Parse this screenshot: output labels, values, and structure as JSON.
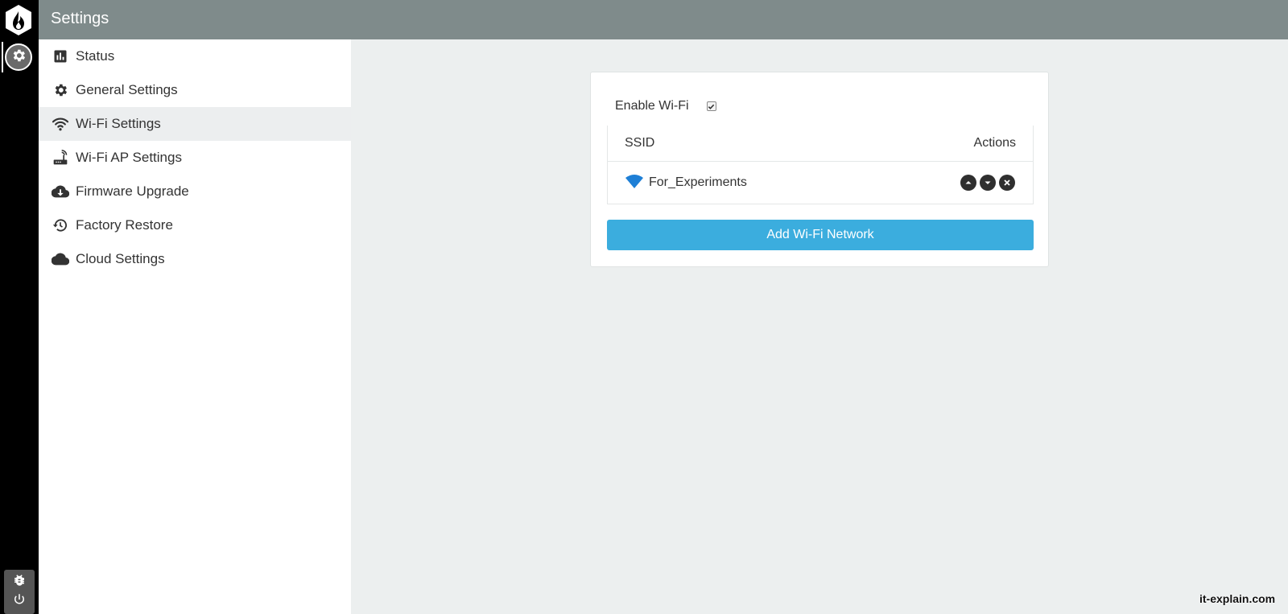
{
  "header": {
    "title": "Settings"
  },
  "sidebar": {
    "items": [
      {
        "label": "Status",
        "icon": "bar-chart-icon",
        "active": false
      },
      {
        "label": "General Settings",
        "icon": "gear-icon",
        "active": false
      },
      {
        "label": "Wi-Fi Settings",
        "icon": "wifi-icon",
        "active": true
      },
      {
        "label": "Wi-Fi AP Settings",
        "icon": "router-icon",
        "active": false
      },
      {
        "label": "Firmware Upgrade",
        "icon": "cloud-download-icon",
        "active": false
      },
      {
        "label": "Factory Restore",
        "icon": "history-icon",
        "active": false
      },
      {
        "label": "Cloud Settings",
        "icon": "cloud-icon",
        "active": false
      }
    ]
  },
  "wifi": {
    "enable_label": "Enable Wi-Fi",
    "enabled": true,
    "table": {
      "col_ssid": "SSID",
      "col_actions": "Actions",
      "rows": [
        {
          "ssid": "For_Experiments"
        }
      ]
    },
    "add_button": "Add Wi-Fi Network"
  },
  "watermark": "it-explain.com",
  "colors": {
    "rail": "#000000",
    "header": "#7f8b8b",
    "accent": "#3badde",
    "wifi_icon": "#1e7fd6",
    "content_bg": "#ecefef"
  }
}
